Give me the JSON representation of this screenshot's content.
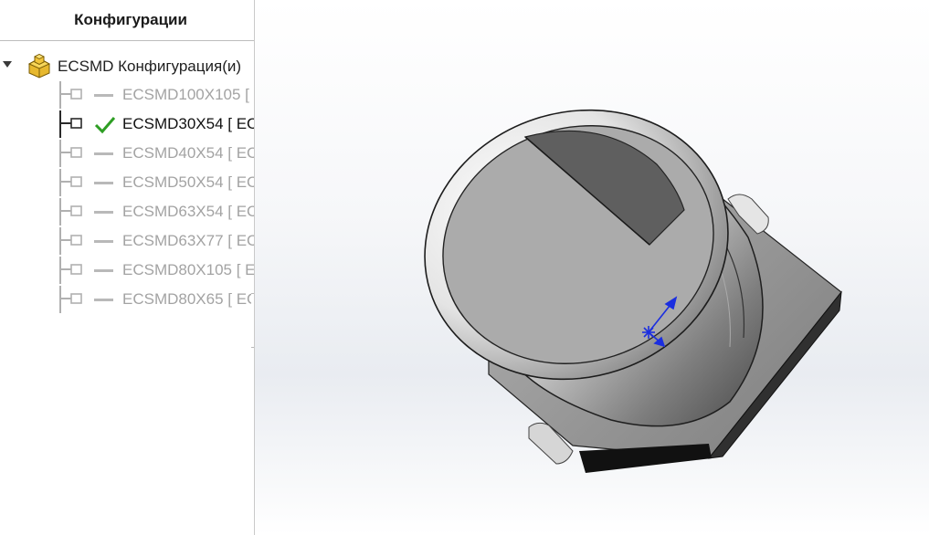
{
  "panel": {
    "title": "Конфигурации",
    "root": {
      "label": "ECSMD Конфигурация(и)",
      "icon": "part-folder-icon"
    },
    "items": [
      {
        "label": "ECSMD100X105 [",
        "active": false
      },
      {
        "label": "ECSMD30X54 [ EC",
        "active": true
      },
      {
        "label": "ECSMD40X54 [ EC",
        "active": false
      },
      {
        "label": "ECSMD50X54 [ EC",
        "active": false
      },
      {
        "label": "ECSMD63X54 [ EC",
        "active": false
      },
      {
        "label": "ECSMD63X77 [ EC",
        "active": false
      },
      {
        "label": "ECSMD80X105 [ E",
        "active": false
      },
      {
        "label": "ECSMD80X65 [ EC",
        "active": false
      }
    ]
  },
  "colors": {
    "check": "#2e9e24",
    "triad": "#1b2ee0",
    "model_dark": "#222222",
    "model_light": "#e6e6e6"
  }
}
